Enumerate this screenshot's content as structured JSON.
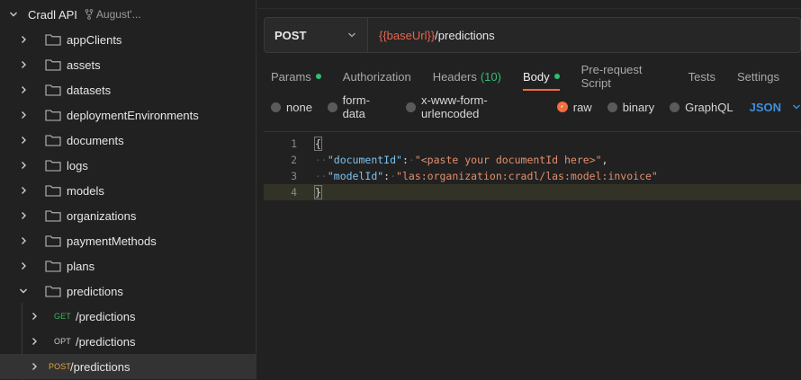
{
  "sidebar": {
    "collection": {
      "title": "Cradl API",
      "fork_label": "August'..."
    },
    "folders": [
      "appClients",
      "assets",
      "datasets",
      "deploymentEnvironments",
      "documents",
      "logs",
      "models",
      "organizations",
      "paymentMethods",
      "plans",
      "predictions"
    ],
    "requests": [
      {
        "method": "GET",
        "path": "/predictions"
      },
      {
        "method": "OPT",
        "path": "/predictions"
      },
      {
        "method": "POST",
        "path": "/predictions"
      }
    ]
  },
  "request": {
    "method": "POST",
    "url_variable": "{{baseUrl}}",
    "url_path": "/predictions"
  },
  "tabs": {
    "params": "Params",
    "authorization": "Authorization",
    "headers": "Headers",
    "headers_count": "(10)",
    "body": "Body",
    "prerequest": "Pre-request Script",
    "tests": "Tests",
    "settings": "Settings"
  },
  "body_types": {
    "none": "none",
    "form_data": "form-data",
    "urlencoded": "x-www-form-urlencoded",
    "raw": "raw",
    "binary": "binary",
    "graphql": "GraphQL",
    "format": "JSON"
  },
  "editor": {
    "line_numbers": [
      "1",
      "2",
      "3",
      "4"
    ],
    "open_brace": "{",
    "close_brace": "}",
    "document_key": "\"documentId\"",
    "document_value": "\"<paste your documentId here>\"",
    "model_key": "\"modelId\"",
    "model_value": "\"las:organization:cradl/las:model:invoice\""
  },
  "colors": {
    "accent": "#f26b3a",
    "get": "#3fae5a",
    "post": "#e0a43a",
    "json": "#3d8fdc",
    "variable": "#e5654f"
  }
}
